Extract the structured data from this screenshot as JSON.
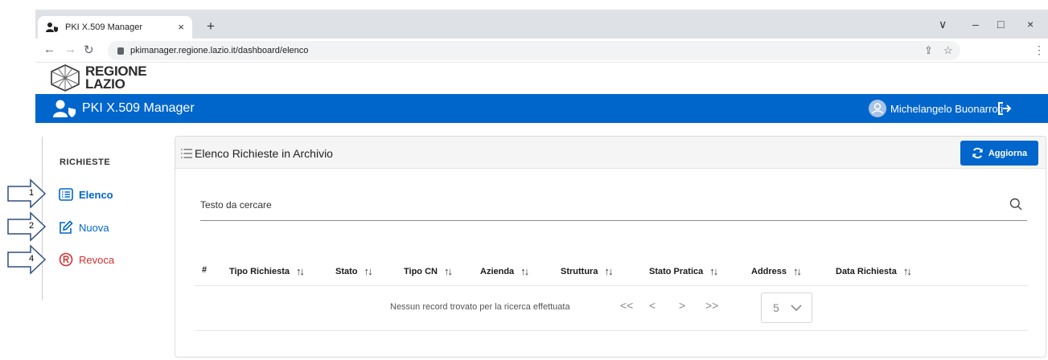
{
  "browser": {
    "tab_title": "PKI X.509 Manager",
    "tab_close": "×",
    "new_tab": "+",
    "url": "pkimanager.regione.lazio.it/dashboard/elenco",
    "window_controls": [
      "∨",
      "–",
      "□",
      "×"
    ]
  },
  "brand": {
    "line1": "REGIONE",
    "line2": "LAZIO"
  },
  "appbar": {
    "app_name": "PKI X.509 Manager",
    "user_name": "Michelangelo Buonarroti"
  },
  "sidebar": {
    "title": "RICHIESTE",
    "items": [
      {
        "label": "Elenco",
        "icon": "list-icon",
        "active": true
      },
      {
        "label": "Nuova",
        "icon": "edit-icon",
        "active": false
      },
      {
        "label": "Revoca",
        "icon": "revoke-icon",
        "active": false
      }
    ]
  },
  "annotations": [
    "1",
    "2",
    "4"
  ],
  "content": {
    "title": "Elenco Richieste in Archivio",
    "refresh_label": "Aggiorna",
    "search_placeholder": "Testo da cercare",
    "columns": [
      "#",
      "Tipo Richiesta",
      "Stato",
      "Tipo CN",
      "Azienda",
      "Struttura",
      "Stato Pratica",
      "Address",
      "Data Richiesta"
    ],
    "sort_glyph": "↑↓",
    "empty_message": "Nessun record trovato per la ricerca effettuata",
    "pager": {
      "first": "<<",
      "prev": "<",
      "next": ">",
      "last": ">>",
      "page_size": "5"
    }
  },
  "colors": {
    "primary": "#0066cc",
    "danger": "#d32f2f",
    "header_bg": "#f5f5f5"
  }
}
